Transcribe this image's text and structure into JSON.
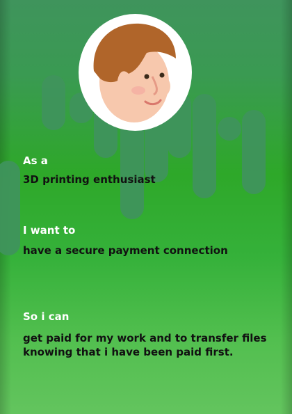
{
  "story": {
    "role_label": "As a",
    "role_value": "3D printing enthusiast",
    "want_label": "I want to",
    "want_value": "have a secure payment connection",
    "benefit_label": "So i can",
    "benefit_value": "get paid for my work and to transfer files knowing that i have been paid first."
  },
  "avatar": {
    "icon": "cartoon-face-icon"
  },
  "colors": {
    "background": "#2ea829",
    "label": "#ffffff",
    "text": "#111111"
  }
}
